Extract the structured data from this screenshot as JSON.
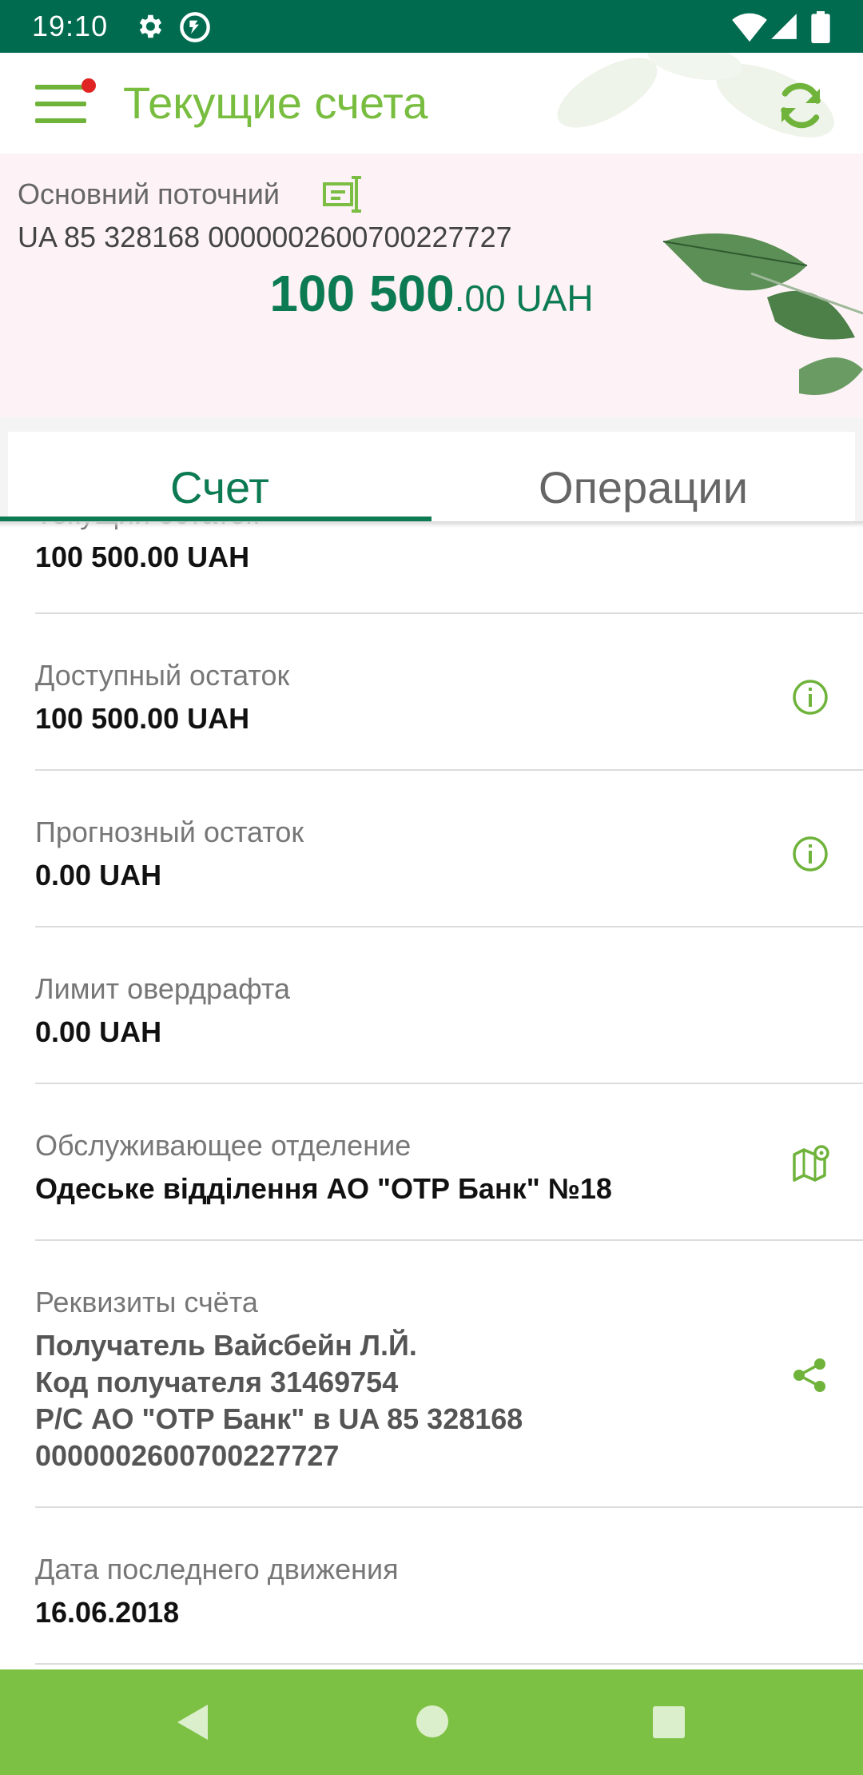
{
  "status_bar": {
    "time": "19:10",
    "icons": [
      "settings-icon",
      "sync-app-icon",
      "wifi-icon",
      "signal-icon",
      "battery-icon"
    ]
  },
  "header": {
    "title": "Текущие счета",
    "menu_icon": "hamburger-menu-icon",
    "refresh_icon": "refresh-icon"
  },
  "account": {
    "name": "Основний поточний",
    "iban": "UA 85 328168 0000002600700227727",
    "balance_major": "100 500",
    "balance_minor": ".00 UAH"
  },
  "tabs": [
    {
      "label": "Счет",
      "active": true
    },
    {
      "label": "Операции",
      "active": false
    }
  ],
  "details": {
    "current_balance": {
      "label": "Текущий остаток",
      "value": "100 500.00 UAH"
    },
    "available_balance": {
      "label": "Доступный остаток",
      "value": "100 500.00 UAH",
      "icon": "info-icon"
    },
    "forecast_balance": {
      "label": "Прогнозный остаток",
      "value": "0.00 UAH",
      "icon": "info-icon"
    },
    "overdraft_limit": {
      "label": "Лимит овердрафта",
      "value": "0.00 UAH"
    },
    "branch": {
      "label": "Обслуживающее отделение",
      "value": "Одеське відділення АО \"ОТР Банк\" №18",
      "icon": "map-pin-icon"
    },
    "requisites": {
      "label": "Реквизиты счёта",
      "lines": [
        "Получатель Вайсбейн Л.Й.",
        "Код получателя 31469754",
        "Р/С АО \"ОТР Банк\" в UA 85 328168",
        "0000002600700227727"
      ],
      "icon": "share-icon"
    },
    "last_movement": {
      "label": "Дата последнего движения",
      "value": "16.06.2018"
    }
  },
  "colors": {
    "status_bar": "#006b4f",
    "brand_green": "#78bd3f",
    "dark_green": "#0c7a52",
    "nav_bar": "#7cc143",
    "notification_dot": "#e02424"
  }
}
